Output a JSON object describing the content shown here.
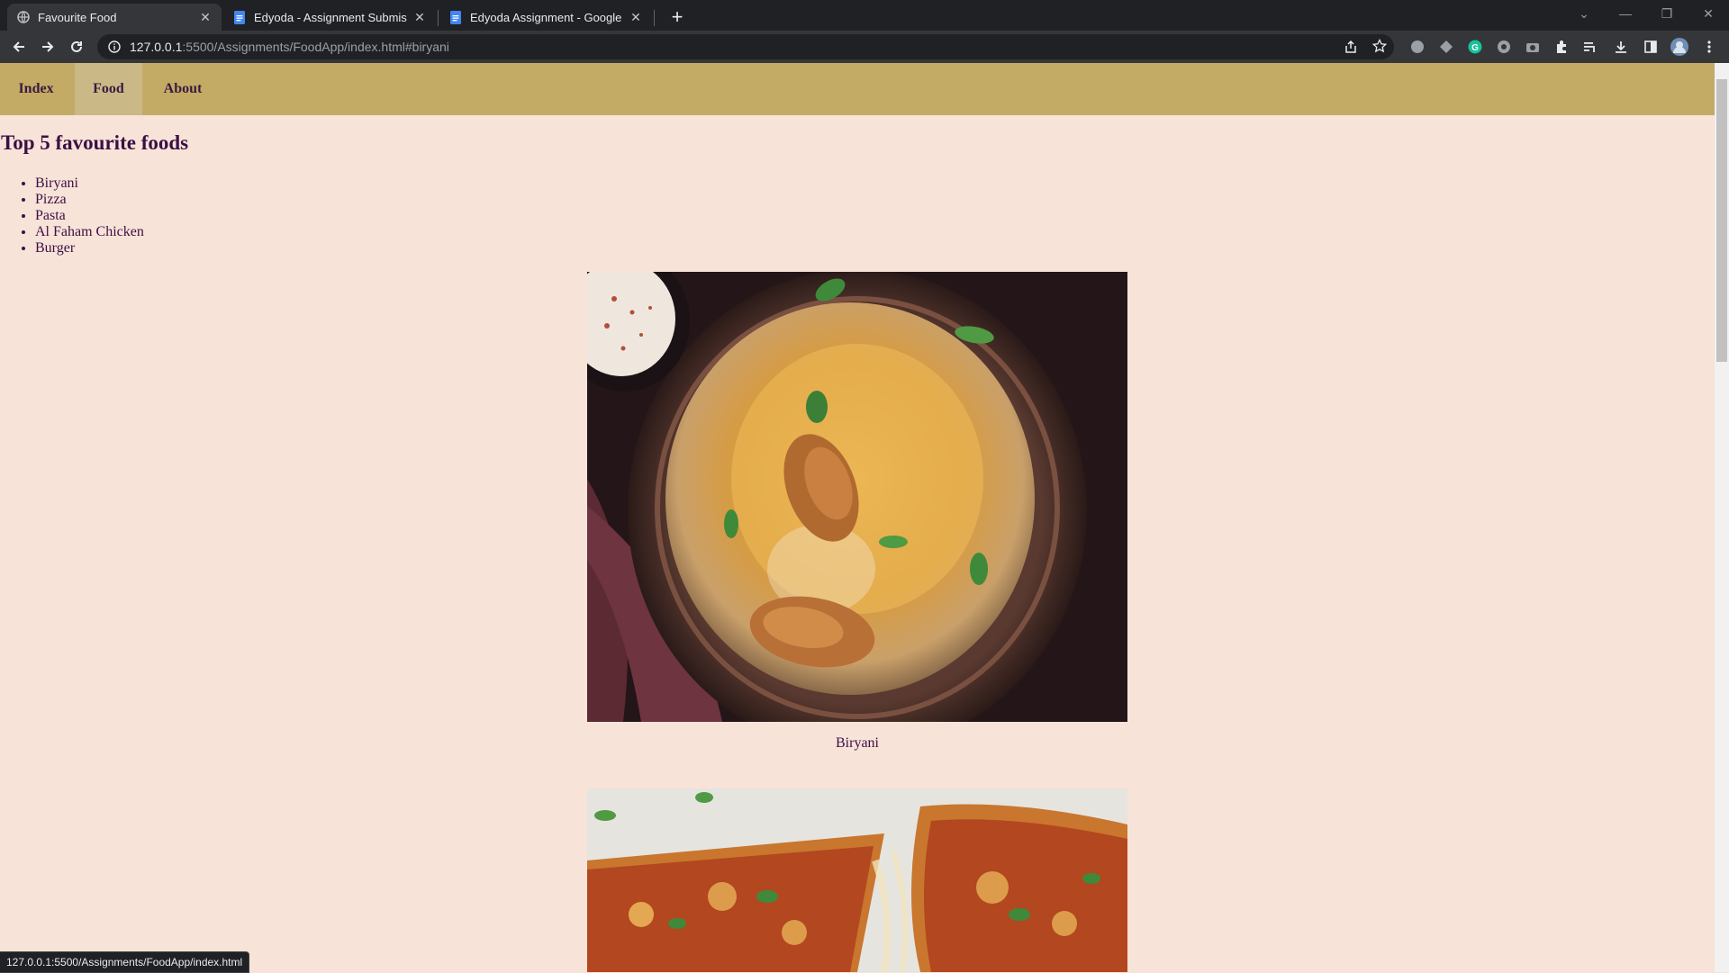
{
  "browser": {
    "tabs": [
      {
        "title": "Favourite Food",
        "icon": "globe-icon",
        "active": true
      },
      {
        "title": "Edyoda - Assignment Submission",
        "icon": "docs-icon",
        "active": false
      },
      {
        "title": "Edyoda Assignment - Google Docs",
        "icon": "docs-icon",
        "active": false
      }
    ],
    "new_tab_symbol": "+",
    "address": {
      "host": "127.0.0.1",
      "rest": ":5500/Assignments/FoodApp/index.html#biryani"
    },
    "status_url": "127.0.0.1:5500/Assignments/FoodApp/index.html"
  },
  "site": {
    "nav": [
      "Index",
      "Food",
      "About"
    ],
    "active_nav": "Food",
    "heading": "Top 5 favourite foods",
    "foods": [
      "Biryani",
      "Pizza",
      "Pasta",
      "Al Faham Chicken",
      "Burger"
    ],
    "images": [
      {
        "caption": "Biryani",
        "alt": "Biryani"
      },
      {
        "caption": "",
        "alt": "Pizza"
      }
    ]
  },
  "colors": {
    "page_bg": "#f8e3d8",
    "nav_bg": "#c3ab66",
    "nav_active_bg": "#cbb887",
    "text": "#3b0f45"
  }
}
